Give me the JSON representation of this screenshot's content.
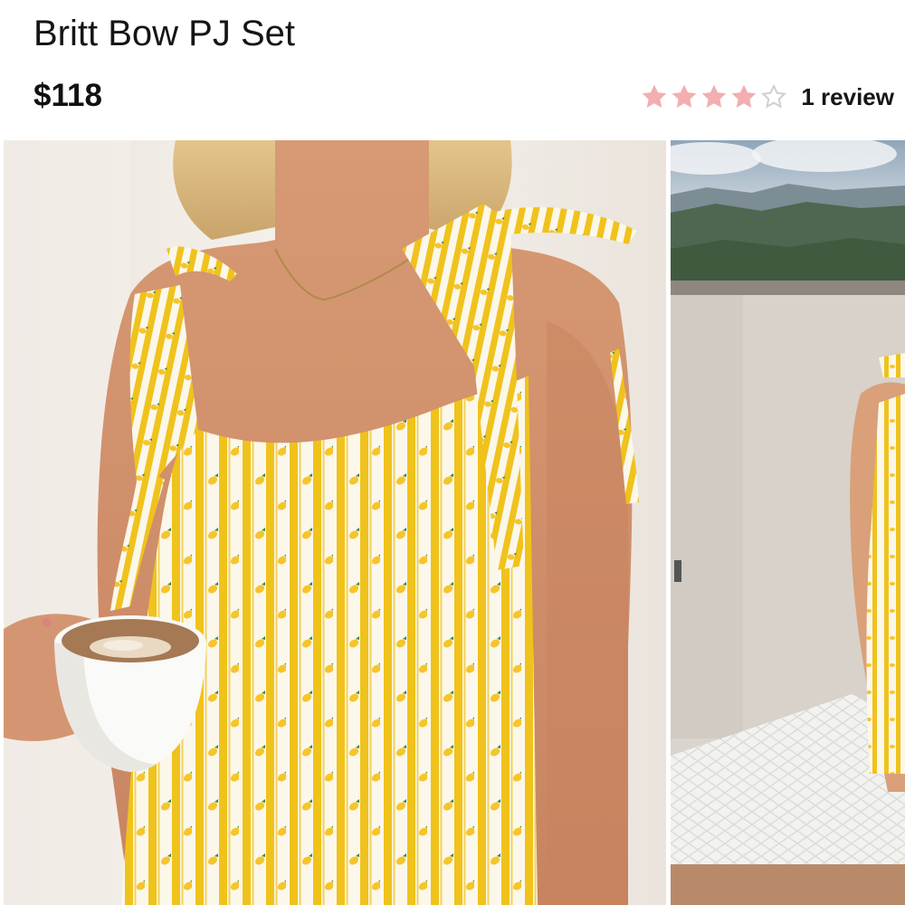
{
  "product": {
    "title": "Britt Bow PJ Set",
    "price": "$118"
  },
  "rating": {
    "value": 4,
    "max": 5,
    "review_link": "1 review",
    "filled_color": "#f2aeb0",
    "empty_color": "#cfcfcf"
  },
  "gallery": {
    "images": [
      {
        "name": "model-holding-coffee-cup-photo",
        "selected": true
      },
      {
        "name": "model-on-terrace-photo",
        "selected": false
      }
    ]
  },
  "colors": {
    "fabric_yellow": "#f0c21c",
    "fabric_white": "#fbf7ea",
    "lemon": "#f5c52a",
    "leaf": "#3e8a3a"
  }
}
